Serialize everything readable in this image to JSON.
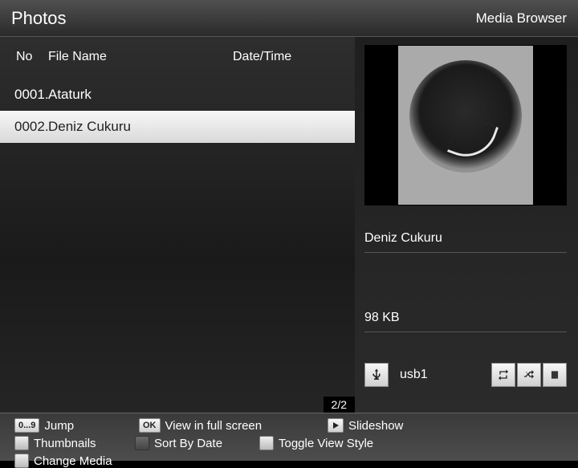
{
  "header": {
    "title": "Photos",
    "subtitle": "Media Browser"
  },
  "table": {
    "columns": {
      "no": "No",
      "name": "File Name",
      "date": "Date/Time"
    },
    "rows": [
      {
        "no": "0001.",
        "name": "Ataturk",
        "date": "",
        "selected": false
      },
      {
        "no": "0002.",
        "name": "Deniz Cukuru",
        "date": "",
        "selected": true
      }
    ],
    "counter": "2/2"
  },
  "preview": {
    "title": "Deniz Cukuru",
    "size": "98 KB",
    "device": "usb1"
  },
  "footer": {
    "jump": {
      "key": "0...9",
      "label": "Jump"
    },
    "ok": {
      "key": "OK",
      "label": "View in full screen"
    },
    "slideshow": {
      "label": "Slideshow"
    },
    "thumbnails": {
      "label": "Thumbnails"
    },
    "sort": {
      "label": "Sort By Date"
    },
    "toggle": {
      "label": "Toggle View Style"
    },
    "change": {
      "label": "Change Media"
    }
  }
}
